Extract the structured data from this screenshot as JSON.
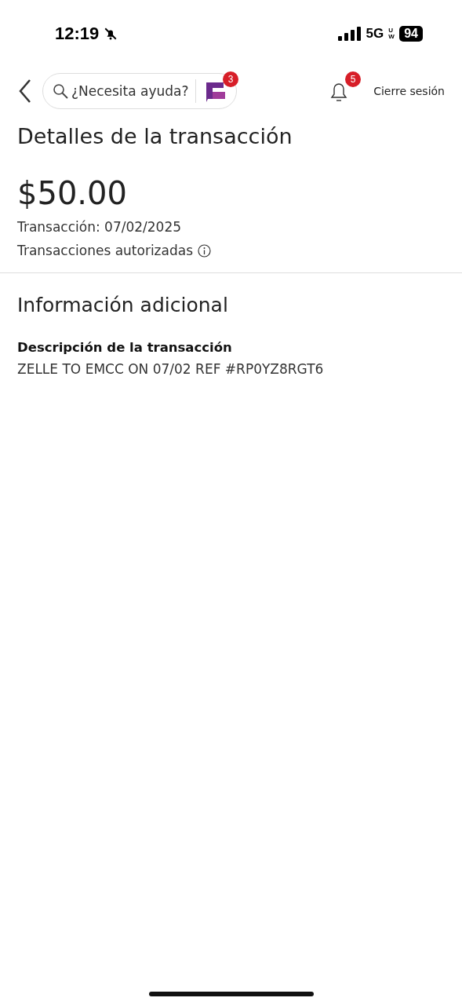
{
  "status_bar": {
    "time": "12:19",
    "network": "5G",
    "network_sub": "UW",
    "battery": "94"
  },
  "nav": {
    "search": {
      "placeholder": "¿Necesita ayuda?"
    },
    "assistant_badge": "3",
    "notifications_badge": "5",
    "logout": "Cierre sesión"
  },
  "title": "Detalles de la transacción",
  "amount": "$50.00",
  "date": "Transacción: 07/02/2025",
  "status": "Transacciones autorizadas",
  "section_title": "Información adicional",
  "details": [
    {
      "label": "Descripción de la transacción",
      "value": "ZELLE TO EMCC ON 07/02 REF #RP0YZ8RGT6"
    }
  ]
}
